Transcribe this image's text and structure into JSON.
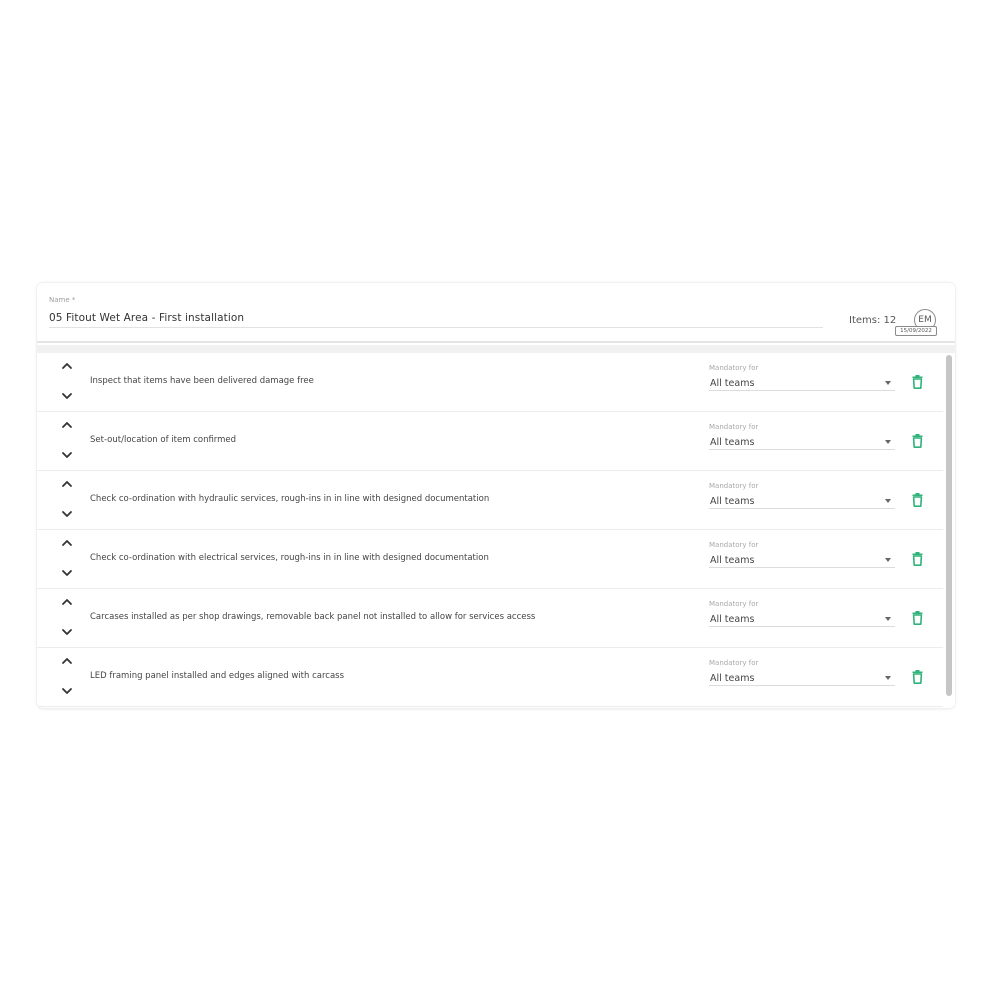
{
  "header": {
    "name_label": "Name *",
    "name_value": "05 Fitout Wet Area - First installation",
    "items_count": "Items: 12",
    "avatar_initials": "EM",
    "avatar_date": "15/09/2022"
  },
  "icons": {
    "move_up": "chevron-up-icon",
    "move_down": "chevron-down-icon",
    "dropdown": "caret-down-icon",
    "delete": "trash-icon"
  },
  "colors": {
    "accent_green": "#2fb37a",
    "divider": "#e4e4e4",
    "label_gray": "#a8a8a8"
  },
  "items": [
    {
      "text": "Inspect that items have been delivered damage free",
      "mandatory_label": "Mandatory for",
      "mandatory_value": "All teams"
    },
    {
      "text": "Set-out/location of item confirmed",
      "mandatory_label": "Mandatory for",
      "mandatory_value": "All teams"
    },
    {
      "text": "Check co-ordination with hydraulic services, rough-ins in in line with designed documentation",
      "mandatory_label": "Mandatory for",
      "mandatory_value": "All teams"
    },
    {
      "text": "Check co-ordination with electrical services, rough-ins in in line with designed documentation",
      "mandatory_label": "Mandatory for",
      "mandatory_value": "All teams"
    },
    {
      "text": "Carcases installed as per shop drawings, removable back panel not installed to allow for services access",
      "mandatory_label": "Mandatory for",
      "mandatory_value": "All teams"
    },
    {
      "text": "LED framing panel installed and edges aligned with carcass",
      "mandatory_label": "Mandatory for",
      "mandatory_value": "All teams"
    }
  ]
}
